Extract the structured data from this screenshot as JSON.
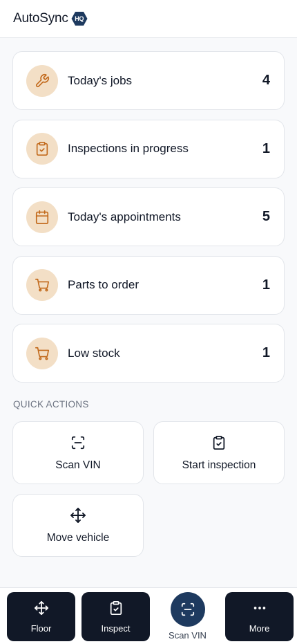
{
  "header": {
    "brand": "AutoSync",
    "badge": "HQ"
  },
  "stats": [
    {
      "label": "Today's jobs",
      "value": "4",
      "icon": "wrench-icon"
    },
    {
      "label": "Inspections in progress",
      "value": "1",
      "icon": "clipboard-check-icon"
    },
    {
      "label": "Today's appointments",
      "value": "5",
      "icon": "calendar-icon"
    },
    {
      "label": "Parts to order",
      "value": "1",
      "icon": "cart-icon"
    },
    {
      "label": "Low stock",
      "value": "1",
      "icon": "cart-icon"
    }
  ],
  "quick_actions": {
    "title": "QUICK ACTIONS",
    "items": [
      {
        "label": "Scan VIN",
        "icon": "scan-icon"
      },
      {
        "label": "Start inspection",
        "icon": "clipboard-check-icon"
      },
      {
        "label": "Move vehicle",
        "icon": "move-icon"
      }
    ]
  },
  "bottom_nav": [
    {
      "label": "Floor",
      "icon": "move-icon"
    },
    {
      "label": "Inspect",
      "icon": "clipboard-check-icon"
    },
    {
      "label": "Scan VIN",
      "icon": "scan-icon"
    },
    {
      "label": "More",
      "icon": "more-dots-icon"
    }
  ],
  "colors": {
    "accent_icon": "#c2691b",
    "icon_circle_bg": "#f3dfc6",
    "nav_dark": "#111827",
    "scan_button": "#1e3a5f"
  }
}
